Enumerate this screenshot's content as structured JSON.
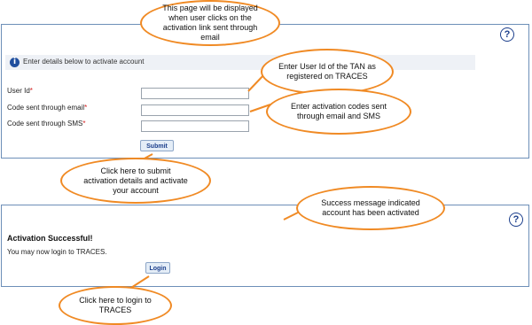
{
  "activation_form": {
    "info_text": "Enter details below to activate account",
    "fields": [
      {
        "label": "User Id",
        "required_mark": "*",
        "value": ""
      },
      {
        "label": "Code sent through email",
        "required_mark": "*",
        "value": ""
      },
      {
        "label": "Code sent through SMS",
        "required_mark": "*",
        "value": ""
      }
    ],
    "submit_label": "Submit",
    "help_glyph": "?"
  },
  "success_panel": {
    "title": "Activation Successful!",
    "message": "You may now login to TRACES.",
    "login_label": "Login",
    "help_glyph": "?"
  },
  "callouts": {
    "page_displayed": "This page will be displayed when user clicks on the activation link sent through email",
    "user_id_hint": "Enter User Id of the TAN as registered on TRACES",
    "codes_hint": "Enter activation codes sent through email and SMS",
    "submit_hint": "Click here to submit activation details and activate your account",
    "success_hint": "Success message indicated account has been activated",
    "login_hint": "Click here to login to TRACES"
  },
  "colors": {
    "panel_border": "#6d8fb8",
    "callout_border": "#f08a24",
    "required": "#d42020",
    "info_bar": "#eef1f6"
  },
  "icons": [
    "help-icon",
    "info-icon"
  ]
}
